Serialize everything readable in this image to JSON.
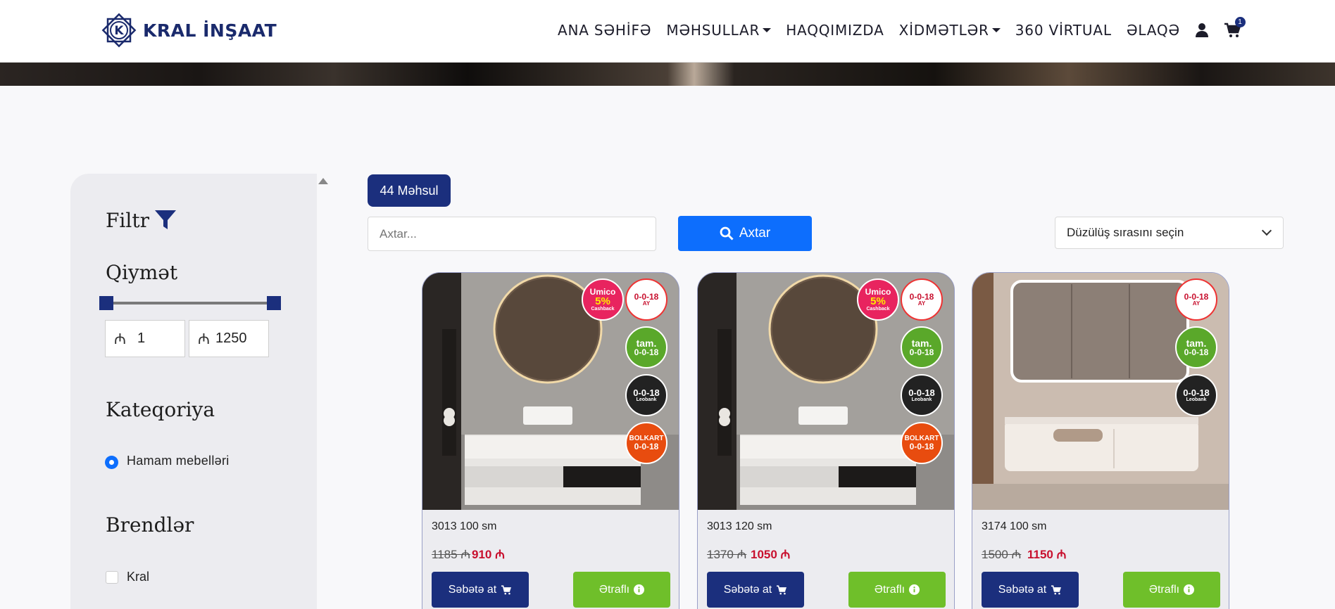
{
  "brand": {
    "name": "KRAL İNŞAAT",
    "logo_letter": "K"
  },
  "nav": {
    "items": [
      {
        "label": "ANA SƏHİFƏ",
        "dropdown": false
      },
      {
        "label": "MƏHSULLAR",
        "dropdown": true
      },
      {
        "label": "HAQQIMIZDA",
        "dropdown": false
      },
      {
        "label": "XİDMƏTLƏR",
        "dropdown": true
      },
      {
        "label": "360 VİRTUAL",
        "dropdown": false
      },
      {
        "label": "ƏLAQƏ",
        "dropdown": false
      }
    ],
    "cart_count": "1",
    "icons": [
      "user-icon",
      "cart-icon"
    ]
  },
  "sidebar": {
    "filter_title": "Filtr",
    "price_title": "Qiymət",
    "currency": "₼",
    "price_min": "1",
    "price_max": "1250",
    "category_title": "Kateqoriya",
    "category_selected": "Hamam mebelləri",
    "brands_title": "Brendlər",
    "brand_item": "Kral"
  },
  "toolbar": {
    "count_label": "44 Məhsul",
    "search_placeholder": "Axtar...",
    "search_button": "Axtar",
    "sort_placeholder": "Düzülüş sırasını seçin"
  },
  "badges": {
    "umico_top": "Umico",
    "umico_pct": "5%",
    "umico_sub": "Cashback",
    "installment": "0-0-18",
    "installment_unit": "AY",
    "tam": "tam.",
    "leo": "Leobank",
    "bolkart": "BOLKART"
  },
  "products": [
    {
      "name": "3013 100 sm",
      "old_price": "1185 ₼",
      "new_price": "910 ₼",
      "cart_label": "Səbətə at",
      "more_label": "Ətraflı",
      "umico": true,
      "bolkart": true,
      "variant": "round"
    },
    {
      "name": "3013 120 sm",
      "old_price": "1370 ₼",
      "new_price": "1050 ₼",
      "cart_label": "Səbətə at",
      "more_label": "Ətraflı",
      "umico": true,
      "bolkart": true,
      "variant": "round"
    },
    {
      "name": "3174 100 sm",
      "old_price": "1500 ₼",
      "new_price": "1150 ₼",
      "cart_label": "Səbətə at",
      "more_label": "Ətraflı",
      "umico": false,
      "bolkart": false,
      "variant": "cabinet"
    }
  ],
  "colors": {
    "primary": "#1b2f7d",
    "accent_blue": "#0d6efd",
    "green": "#6fbf2a",
    "sale_red": "#c8102e"
  }
}
